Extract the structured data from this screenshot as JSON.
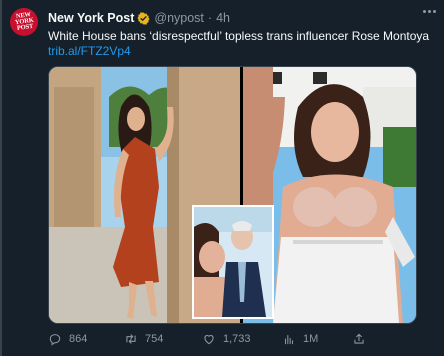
{
  "author": {
    "avatar_text": "NEW YORK POST",
    "display_name": "New York Post",
    "handle": "@nypost",
    "separator": "·",
    "time": "4h"
  },
  "tweet": {
    "text": "White House bans ‘disrespectful’ topless trans influencer Rose Montoya",
    "link": "trib.al/FTZ2Vp4"
  },
  "media": {
    "left_photo": "woman-in-red-dress",
    "right_photo": "topless-woman-at-white-house",
    "inset_photo": "selfie-with-man-in-suit"
  },
  "actions": {
    "replies": "864",
    "retweets": "754",
    "likes": "1,733",
    "views": "1M"
  },
  "colors": {
    "background": "#15202b",
    "text": "#f7f9f9",
    "muted": "#8b98a5",
    "link": "#1d9bf0",
    "verified": "#e8b51f",
    "avatar": "#c8102e"
  }
}
